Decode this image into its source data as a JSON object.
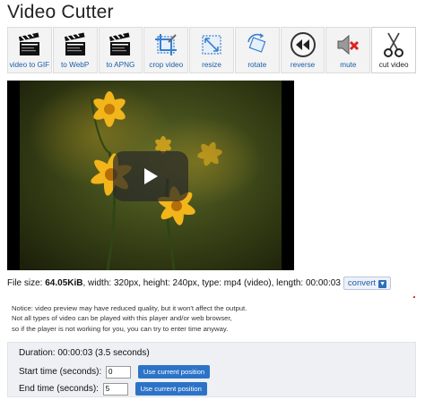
{
  "header": {
    "title": "Video Cutter"
  },
  "toolbar": {
    "items": [
      {
        "label": "video to GIF",
        "icon": "clapperboard-icon"
      },
      {
        "label": "to WebP",
        "icon": "clapperboard-icon"
      },
      {
        "label": "to APNG",
        "icon": "clapperboard-icon"
      },
      {
        "label": "crop video",
        "icon": "crop-icon"
      },
      {
        "label": "resize",
        "icon": "resize-icon"
      },
      {
        "label": "rotate",
        "icon": "rotate-icon"
      },
      {
        "label": "reverse",
        "icon": "rewind-icon"
      },
      {
        "label": "mute",
        "icon": "mute-speaker-icon"
      },
      {
        "label": "cut video",
        "icon": "scissors-icon",
        "active": true
      }
    ]
  },
  "player": {
    "play_icon": "play-icon"
  },
  "fileinfo": {
    "size_label": "File size: ",
    "size_value": "64.05KiB",
    "rest": ", width: 320px, height: 240px, type: mp4 (video), length: 00:00:03",
    "convert_label": "convert"
  },
  "notice": {
    "line1": "Notice: video preview may have reduced quality, but it won't affect the output.",
    "line2": "Not all types of video can be played with this player and/or web browser,",
    "line3": "so if the player is not working for you, you can try to enter time anyway."
  },
  "cutter": {
    "duration_label": "Duration: 00:00:03 (3.5 seconds)",
    "start_label": "Start time (seconds):",
    "start_value": "0",
    "end_label": "End time (seconds):",
    "end_value": "5",
    "use_current_label": "Use current position"
  },
  "colors": {
    "link": "#1a5ea8",
    "button": "#2c73c8",
    "panel": "#eef0f3"
  }
}
